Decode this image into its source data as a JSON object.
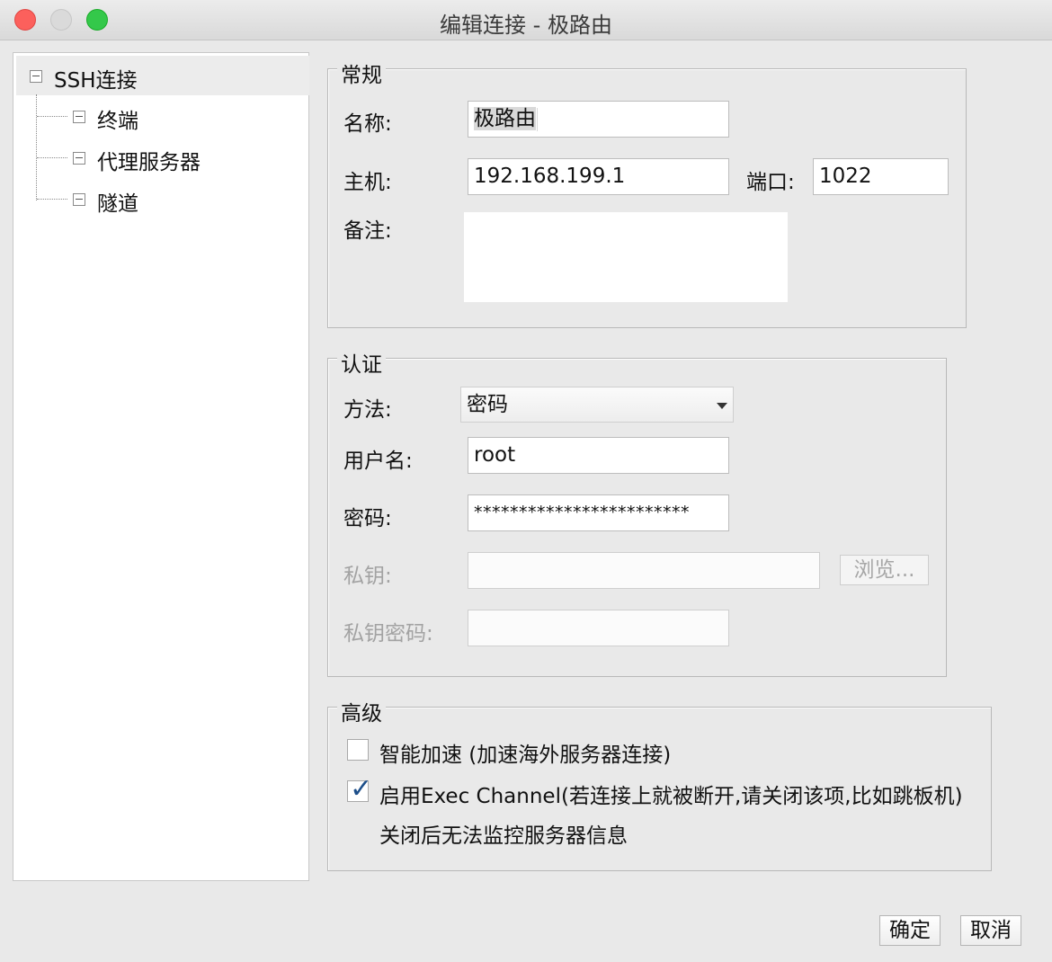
{
  "window": {
    "title": "编辑连接 - 极路由"
  },
  "tree": {
    "root": "SSH连接",
    "children": [
      "终端",
      "代理服务器",
      "隧道"
    ]
  },
  "general": {
    "legend": "常规",
    "name_label": "名称:",
    "name_value": "极路由",
    "host_label": "主机:",
    "host_value": "192.168.199.1",
    "port_label": "端口:",
    "port_value": "1022",
    "note_label": "备注:",
    "note_value": ""
  },
  "auth": {
    "legend": "认证",
    "method_label": "方法:",
    "method_value": "密码",
    "user_label": "用户名:",
    "user_value": "root",
    "password_label": "密码:",
    "password_value": "************************",
    "key_label": "私钥:",
    "key_value": "",
    "browse_label": "浏览...",
    "key_password_label": "私钥密码:",
    "key_password_value": ""
  },
  "advanced": {
    "legend": "高级",
    "smart_accel_label": "智能加速 (加速海外服务器连接)",
    "smart_accel_checked": false,
    "exec_channel_label": "启用Exec Channel(若连接上就被断开,请关闭该项,比如跳板机)",
    "exec_channel_checked": true,
    "exec_channel_note": "关闭后无法监控服务器信息"
  },
  "footer": {
    "ok_label": "确定",
    "cancel_label": "取消"
  },
  "colors": {
    "close": "#fc605c",
    "minimize": "#dadada",
    "maximize": "#34c84a",
    "check": "#1d4f8a"
  }
}
